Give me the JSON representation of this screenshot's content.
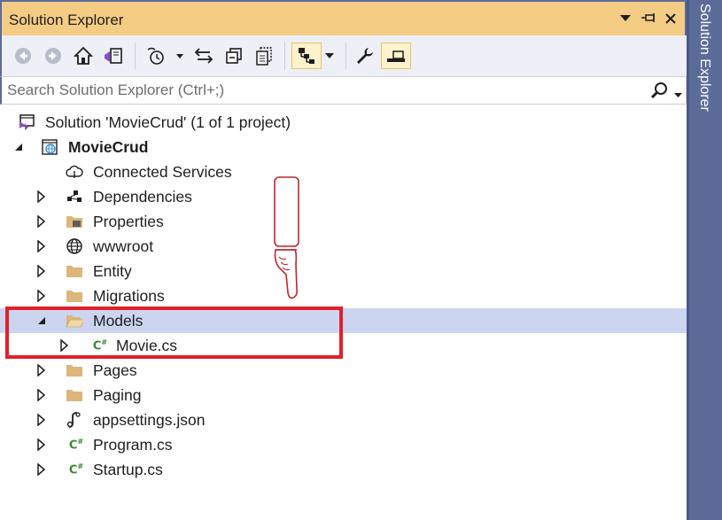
{
  "window": {
    "title": "Solution Explorer",
    "vertical_tab_label": "Solution Explorer"
  },
  "toolbar": {
    "buttons": [
      "back-icon",
      "forward-icon",
      "home-icon",
      "switch-views-icon",
      "pending-changes-filter-icon",
      "sync-icon",
      "collapse-all-icon",
      "show-all-files-icon",
      "preview-selected-icon",
      "properties-icon",
      "pin-preview-icon"
    ]
  },
  "search": {
    "placeholder": "Search Solution Explorer (Ctrl+;)"
  },
  "tree": {
    "solution": {
      "label": "Solution 'MovieCrud' (1 of 1 project)",
      "icon": "solution-icon"
    },
    "project": {
      "label": "MovieCrud",
      "icon": "web-project-icon",
      "expanded": true
    },
    "items": [
      {
        "label": "Connected Services",
        "icon": "cloud-icon",
        "expandable": false
      },
      {
        "label": "Dependencies",
        "icon": "dependencies-icon",
        "expandable": true
      },
      {
        "label": "Properties",
        "icon": "properties-folder-icon",
        "expandable": true
      },
      {
        "label": "wwwroot",
        "icon": "globe-icon",
        "expandable": true
      },
      {
        "label": "Entity",
        "icon": "folder-icon",
        "expandable": true
      },
      {
        "label": "Migrations",
        "icon": "folder-icon",
        "expandable": true
      },
      {
        "label": "Models",
        "icon": "open-folder-icon",
        "expandable": true,
        "expanded": true,
        "selected": true
      },
      {
        "label": "Movie.cs",
        "icon": "csharp-file-icon",
        "expandable": true,
        "child": true
      },
      {
        "label": "Pages",
        "icon": "folder-icon",
        "expandable": true
      },
      {
        "label": "Paging",
        "icon": "folder-icon",
        "expandable": true
      },
      {
        "label": "appsettings.json",
        "icon": "json-file-icon",
        "expandable": true
      },
      {
        "label": "Program.cs",
        "icon": "csharp-file-icon",
        "expandable": true
      },
      {
        "label": "Startup.cs",
        "icon": "csharp-file-icon",
        "expandable": true
      }
    ]
  },
  "colors": {
    "title_bar": "#f5cc84",
    "frame": "#5d6b99",
    "selection": "#ccd5f0",
    "annotation_red": "#e32028"
  }
}
